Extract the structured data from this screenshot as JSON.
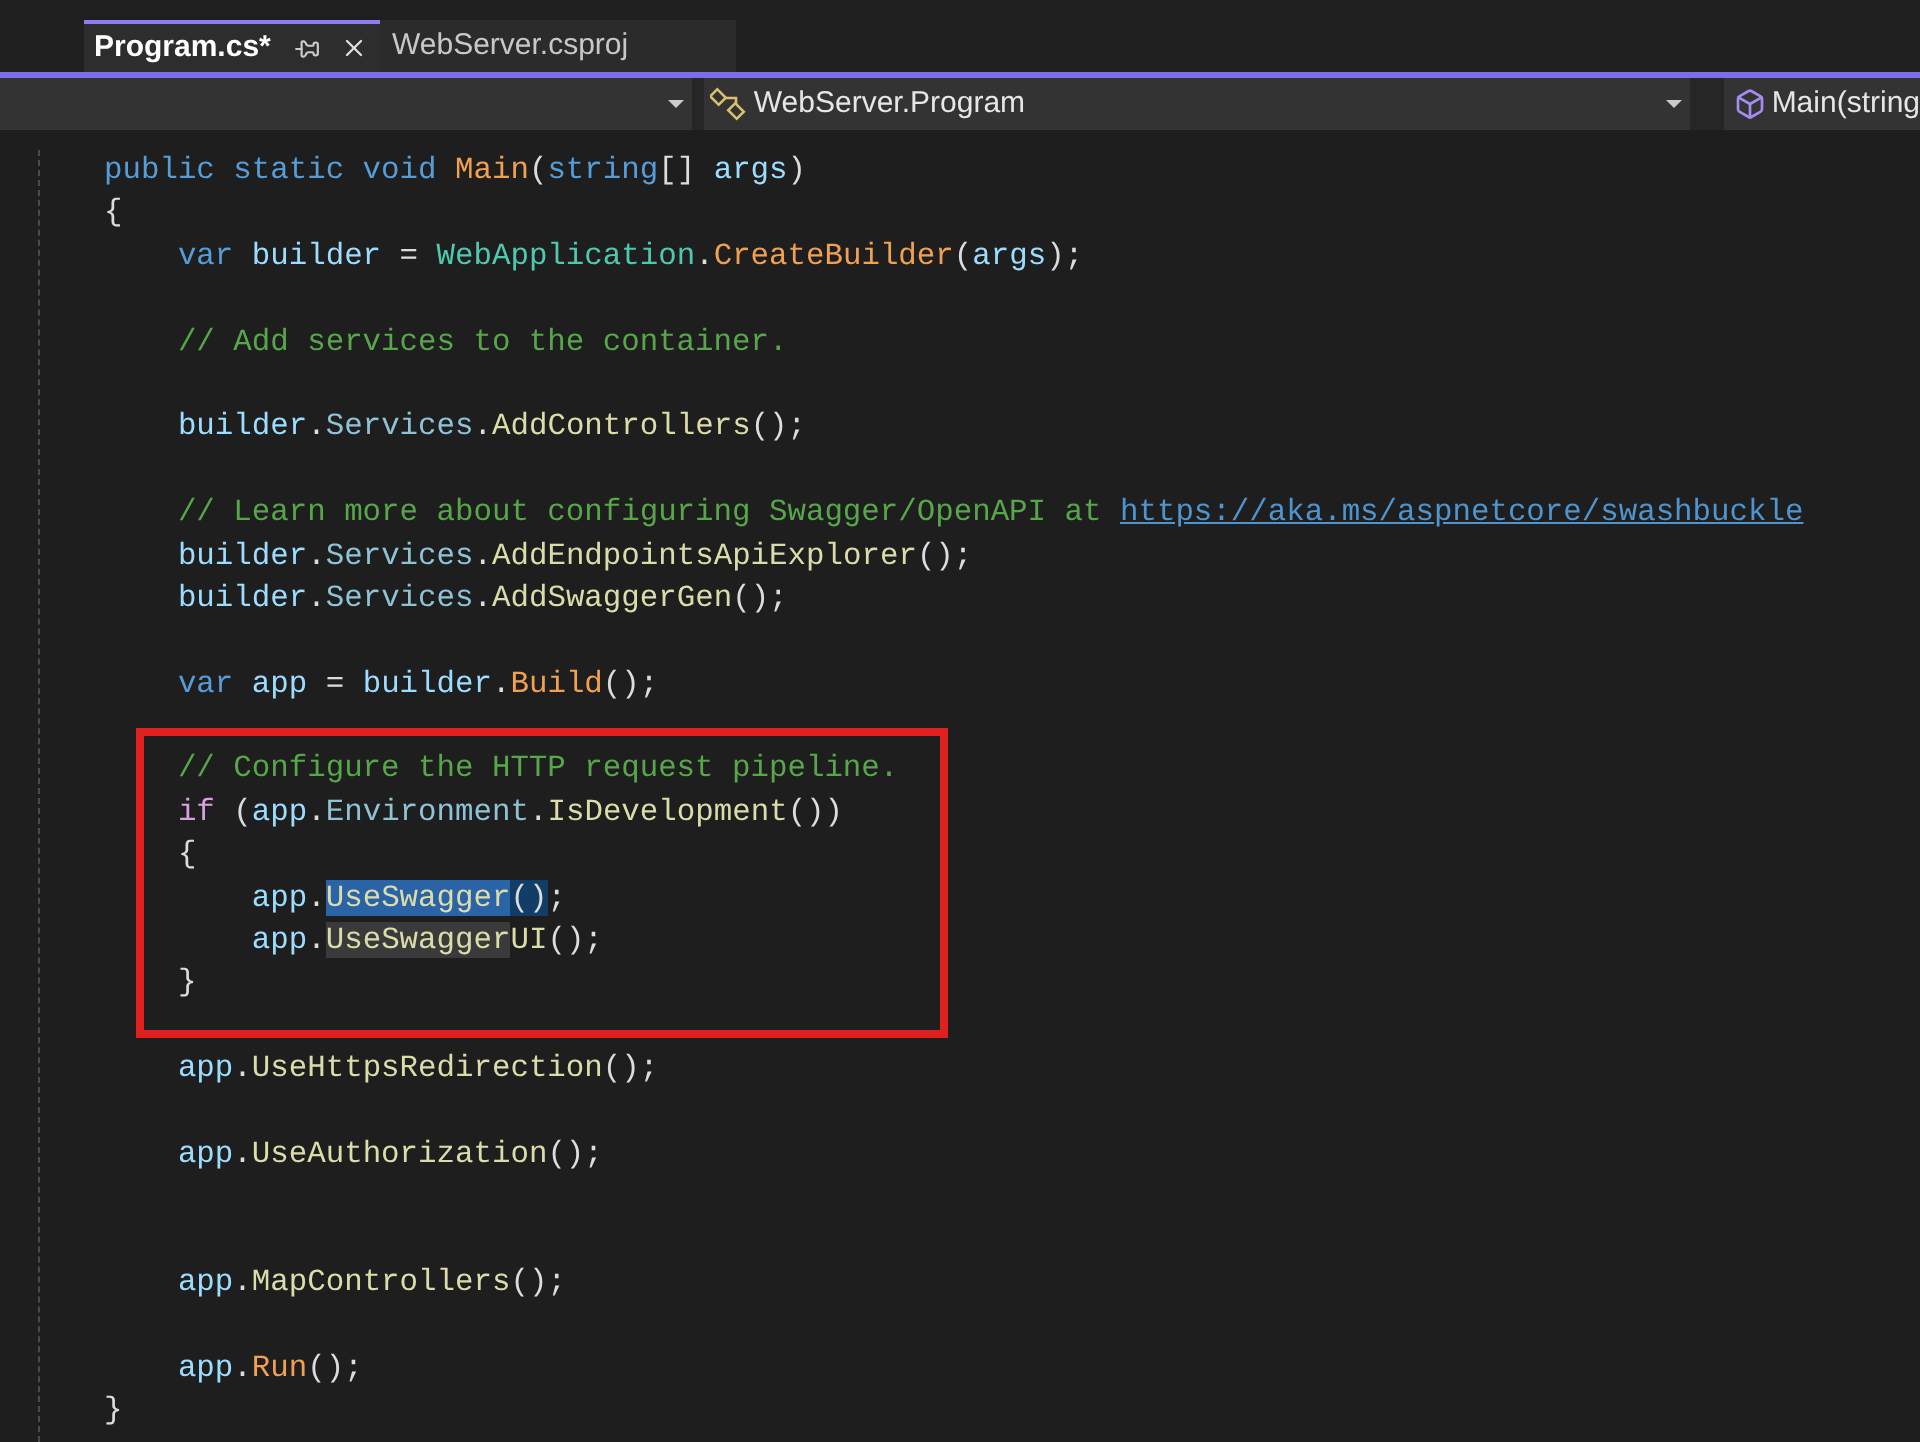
{
  "tabs": [
    {
      "label": "Program.cs*",
      "selected": true
    },
    {
      "label": "WebServer.csproj",
      "selected": false
    }
  ],
  "navigation_bar": {
    "type_scope": "WebServer.Program",
    "member": "Main(string"
  },
  "code": {
    "blocks": [
      {
        "kind": "plain",
        "lines": [
          {
            "kind": "code",
            "tokens": [
              {
                "text": "public static void ",
                "kind": "keyword"
              },
              {
                "text": "Main",
                "kind": "static_method"
              },
              {
                "text": "(",
                "kind": "plain"
              },
              {
                "text": "string",
                "kind": "keyword"
              },
              {
                "text": "[] ",
                "kind": "plain"
              },
              {
                "text": "args",
                "kind": "local"
              },
              {
                "text": ")",
                "kind": "plain"
              }
            ]
          },
          {
            "kind": "code",
            "tokens": [
              {
                "text": "{",
                "kind": "plain"
              }
            ]
          },
          {
            "kind": "code",
            "tokens": [
              {
                "text": "    var ",
                "kind": "keyword"
              },
              {
                "text": "builder",
                "kind": "local"
              },
              {
                "text": " = ",
                "kind": "plain"
              },
              {
                "text": "WebApplication",
                "kind": "type"
              },
              {
                "text": ".",
                "kind": "plain"
              },
              {
                "text": "CreateBuilder",
                "kind": "static_method"
              },
              {
                "text": "(",
                "kind": "plain"
              },
              {
                "text": "args",
                "kind": "local"
              },
              {
                "text": ");",
                "kind": "plain"
              }
            ]
          },
          {
            "kind": "blank"
          },
          {
            "kind": "code",
            "tokens": [
              {
                "text": "    // Add services to the container.",
                "kind": "comment"
              }
            ]
          },
          {
            "kind": "blank"
          },
          {
            "kind": "code",
            "tokens": [
              {
                "text": "    builder",
                "kind": "local"
              },
              {
                "text": ".",
                "kind": "plain"
              },
              {
                "text": "Services",
                "kind": "property"
              },
              {
                "text": ".",
                "kind": "plain"
              },
              {
                "text": "AddControllers",
                "kind": "method"
              },
              {
                "text": "();",
                "kind": "plain"
              }
            ]
          },
          {
            "kind": "blank"
          },
          {
            "kind": "code",
            "tokens": [
              {
                "text": "    // Learn more about configuring Swagger/OpenAPI at ",
                "kind": "comment"
              },
              {
                "text": "https://aka.ms/aspnetcore/swashbuckle",
                "kind": "link"
              }
            ]
          },
          {
            "kind": "code",
            "tokens": [
              {
                "text": "    builder",
                "kind": "local"
              },
              {
                "text": ".",
                "kind": "plain"
              },
              {
                "text": "Services",
                "kind": "property"
              },
              {
                "text": ".",
                "kind": "plain"
              },
              {
                "text": "AddEndpointsApiExplorer",
                "kind": "method"
              },
              {
                "text": "();",
                "kind": "plain"
              }
            ]
          },
          {
            "kind": "code",
            "tokens": [
              {
                "text": "    builder",
                "kind": "local"
              },
              {
                "text": ".",
                "kind": "plain"
              },
              {
                "text": "Services",
                "kind": "property"
              },
              {
                "text": ".",
                "kind": "plain"
              },
              {
                "text": "AddSwaggerGen",
                "kind": "method"
              },
              {
                "text": "();",
                "kind": "plain"
              }
            ]
          },
          {
            "kind": "blank"
          },
          {
            "kind": "code",
            "tokens": [
              {
                "text": "    var ",
                "kind": "keyword"
              },
              {
                "text": "app",
                "kind": "local"
              },
              {
                "text": " = ",
                "kind": "plain"
              },
              {
                "text": "builder",
                "kind": "local"
              },
              {
                "text": ".",
                "kind": "plain"
              },
              {
                "text": "Build",
                "kind": "static_method"
              },
              {
                "text": "();",
                "kind": "plain"
              }
            ]
          },
          {
            "kind": "blank"
          }
        ]
      },
      {
        "kind": "boxed",
        "lines": [
          {
            "kind": "code",
            "tokens": [
              {
                "text": "    // Configure the HTTP request pipeline.",
                "kind": "comment"
              }
            ]
          },
          {
            "kind": "code",
            "tokens": [
              {
                "text": "    if",
                "kind": "control"
              },
              {
                "text": " (",
                "kind": "plain"
              },
              {
                "text": "app",
                "kind": "local"
              },
              {
                "text": ".",
                "kind": "plain"
              },
              {
                "text": "Environment",
                "kind": "property"
              },
              {
                "text": ".",
                "kind": "plain"
              },
              {
                "text": "IsDevelopment",
                "kind": "method"
              },
              {
                "text": "())",
                "kind": "plain"
              }
            ]
          },
          {
            "kind": "code",
            "tokens": [
              {
                "text": "    {",
                "kind": "plain"
              }
            ]
          },
          {
            "kind": "code",
            "tokens": [
              {
                "text": "        app",
                "kind": "local"
              },
              {
                "text": ".",
                "kind": "plain"
              },
              {
                "text": "UseSwagger",
                "kind": "method",
                "selected": true
              },
              {
                "text": "()",
                "kind": "plain",
                "brace_match": true
              },
              {
                "text": ";",
                "kind": "plain"
              }
            ]
          },
          {
            "kind": "code",
            "tokens": [
              {
                "text": "        app",
                "kind": "local"
              },
              {
                "text": ".",
                "kind": "plain"
              },
              {
                "text": "UseSwagger",
                "kind": "method",
                "reference_highlight": true
              },
              {
                "text": "UI",
                "kind": "method"
              },
              {
                "text": "();",
                "kind": "plain"
              }
            ]
          },
          {
            "kind": "code",
            "tokens": [
              {
                "text": "    }",
                "kind": "plain"
              }
            ]
          }
        ]
      },
      {
        "kind": "plain",
        "lines": [
          {
            "kind": "blank"
          },
          {
            "kind": "code",
            "tokens": [
              {
                "text": "    app",
                "kind": "local"
              },
              {
                "text": ".",
                "kind": "plain"
              },
              {
                "text": "UseHttpsRedirection",
                "kind": "method"
              },
              {
                "text": "();",
                "kind": "plain"
              }
            ]
          },
          {
            "kind": "blank"
          },
          {
            "kind": "code",
            "tokens": [
              {
                "text": "    app",
                "kind": "local"
              },
              {
                "text": ".",
                "kind": "plain"
              },
              {
                "text": "UseAuthorization",
                "kind": "method"
              },
              {
                "text": "();",
                "kind": "plain"
              }
            ]
          },
          {
            "kind": "blank"
          },
          {
            "kind": "blank"
          },
          {
            "kind": "code",
            "tokens": [
              {
                "text": "    app",
                "kind": "local"
              },
              {
                "text": ".",
                "kind": "plain"
              },
              {
                "text": "MapControllers",
                "kind": "method"
              },
              {
                "text": "();",
                "kind": "plain"
              }
            ]
          },
          {
            "kind": "blank"
          },
          {
            "kind": "code",
            "tokens": [
              {
                "text": "    app",
                "kind": "local"
              },
              {
                "text": ".",
                "kind": "plain"
              },
              {
                "text": "Run",
                "kind": "static_method"
              },
              {
                "text": "();",
                "kind": "plain"
              }
            ]
          },
          {
            "kind": "code",
            "tokens": [
              {
                "text": "}",
                "kind": "plain"
              }
            ]
          }
        ]
      }
    ]
  }
}
